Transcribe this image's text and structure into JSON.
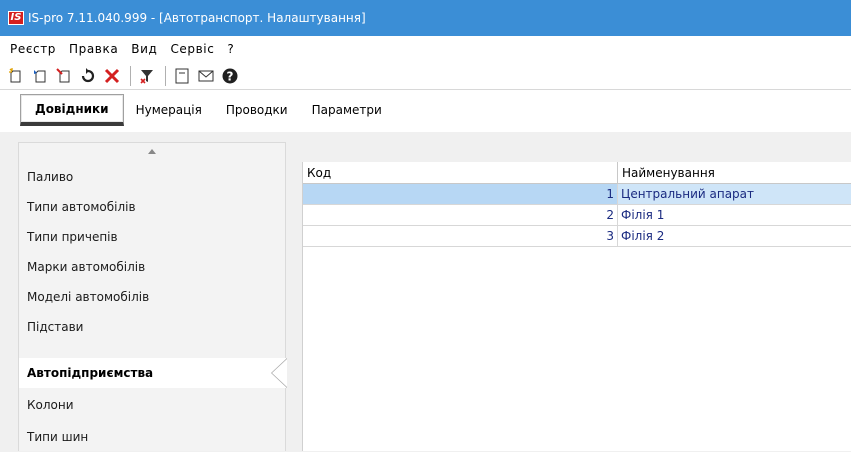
{
  "window": {
    "logo": "IS",
    "title": "IS-pro 7.11.040.999 - [Автотранспорт. Налаштування]"
  },
  "menu": [
    "Реєстр",
    "Правка",
    "Вид",
    "Сервіс",
    "?"
  ],
  "toolbar": {
    "icons": [
      "new-icon",
      "copy-icon",
      "edit-icon",
      "refresh-icon",
      "delete-icon",
      "filter-icon",
      "form-icon",
      "mail-icon",
      "help-icon"
    ],
    "colors": {
      "accent_red": "#d42020",
      "help_dark": "#202020"
    }
  },
  "tabs": [
    {
      "label": "Довідники",
      "active": true
    },
    {
      "label": "Нумерація",
      "active": false
    },
    {
      "label": "Проводки",
      "active": false
    },
    {
      "label": "Параметри",
      "active": false
    }
  ],
  "nav": [
    {
      "label": "Паливо",
      "active": false
    },
    {
      "label": "Типи автомобілів",
      "active": false
    },
    {
      "label": "Типи причепів",
      "active": false
    },
    {
      "label": "Марки автомобілів",
      "active": false
    },
    {
      "label": "Моделі автомобілів",
      "active": false
    },
    {
      "label": "Підстави",
      "active": false
    },
    {
      "label": "Автопідприємства",
      "active": true
    },
    {
      "label": "Колони",
      "active": false
    },
    {
      "label": "Типи шин",
      "active": false
    }
  ],
  "grid": {
    "columns": [
      "Код",
      "Найменування"
    ],
    "rows": [
      {
        "code": "1",
        "name": "Центральний апарат",
        "selected": true
      },
      {
        "code": "2",
        "name": "Філія  1",
        "selected": false
      },
      {
        "code": "3",
        "name": "Філія 2",
        "selected": false
      }
    ]
  },
  "colors": {
    "titlebar": "#3b8ed6",
    "selection": "#b7d7f4",
    "grid_text": "#1a2a80"
  }
}
